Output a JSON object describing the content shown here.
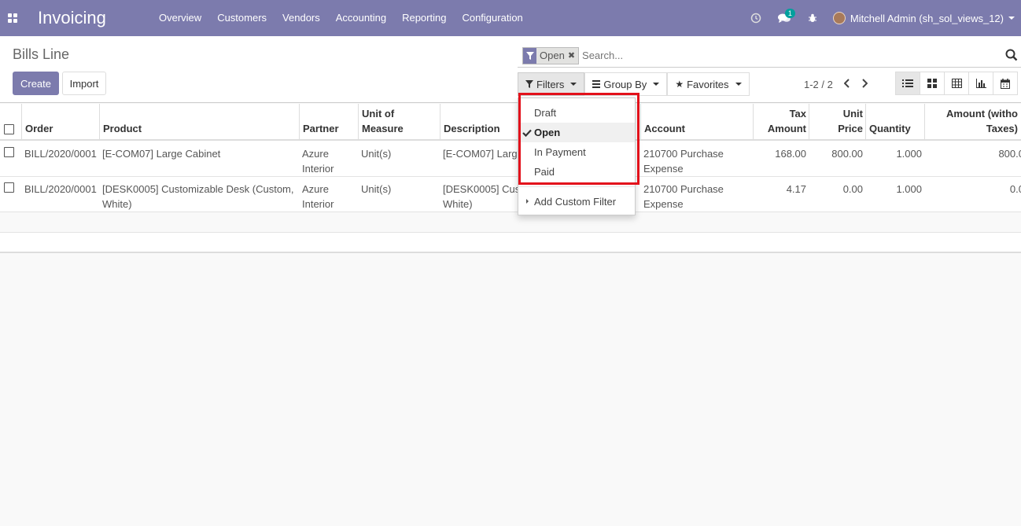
{
  "navbar": {
    "app_title": "Invoicing",
    "menu": [
      "Overview",
      "Customers",
      "Vendors",
      "Accounting",
      "Reporting",
      "Configuration"
    ],
    "messages_badge": "1",
    "user": "Mitchell Admin (sh_sol_views_12)"
  },
  "control": {
    "breadcrumb": "Bills Line",
    "create_label": "Create",
    "import_label": "Import",
    "facet_label": "Open",
    "search_placeholder": "Search...",
    "filters_label": "Filters",
    "groupby_label": "Group By",
    "favorites_label": "Favorites",
    "pager": "1-2 / 2"
  },
  "filters_menu": {
    "items": [
      "Draft",
      "Open",
      "In Payment",
      "Paid"
    ],
    "checked": "Open",
    "custom": "Add Custom Filter"
  },
  "table": {
    "headers": {
      "order": "Order",
      "product": "Product",
      "partner": "Partner",
      "uom_1": "Unit of",
      "uom_2": "Measure",
      "description": "Description",
      "account": "Account",
      "tax_1": "Tax",
      "tax_2": "Amount",
      "price_1": "Unit",
      "price_2": "Price",
      "quantity": "Quantity",
      "amount_1": "Amount (witho",
      "amount_2": "Taxes)"
    },
    "rows": [
      {
        "order": "BILL/2020/0001",
        "product_1": "[E-COM07] Large Cabinet",
        "product_2": "",
        "partner_1": "Azure",
        "partner_2": "Interior",
        "uom": "Unit(s)",
        "description_1": "[E-COM07] Larg",
        "description_2": "",
        "account_1": "210700 Purchase",
        "account_2": "Expense",
        "tax": "168.00",
        "price": "800.00",
        "quantity": "1.000",
        "amount": "800.0"
      },
      {
        "order": "BILL/2020/0001",
        "product_1": "[DESK0005] Customizable Desk (Custom,",
        "product_2": "White)",
        "partner_1": "Azure",
        "partner_2": "Interior",
        "uom": "Unit(s)",
        "description_1": "[DESK0005] Cus",
        "description_2": "White)",
        "account_1": "210700 Purchase",
        "account_2": "Expense",
        "tax": "4.17",
        "price": "0.00",
        "quantity": "1.000",
        "amount": "0.0"
      }
    ]
  },
  "colors": {
    "brand": "#7c7bad",
    "highlight": "#e3111b",
    "badge": "#00a09d"
  }
}
